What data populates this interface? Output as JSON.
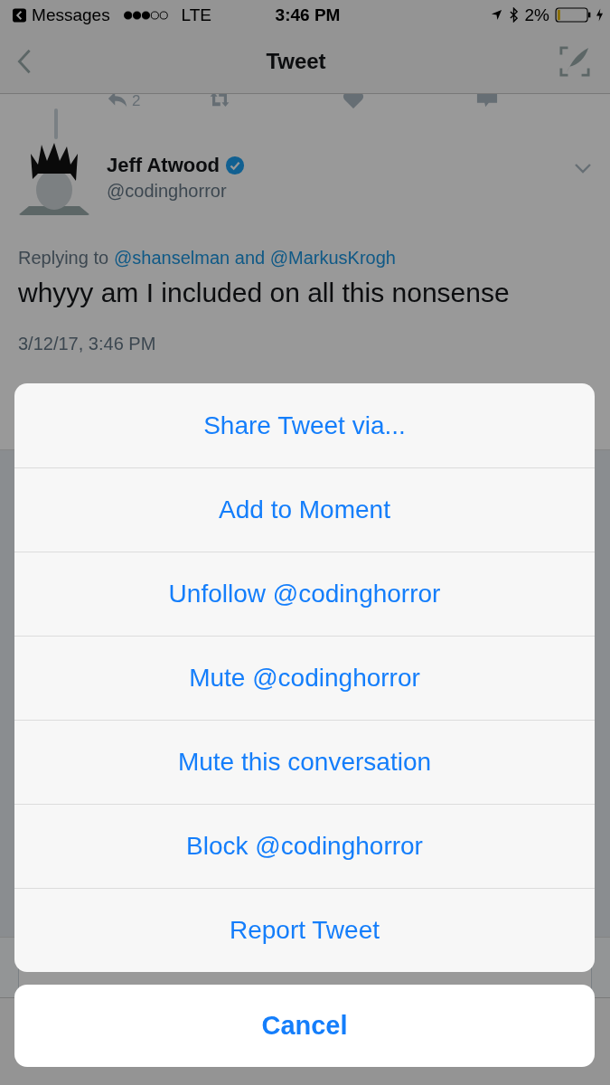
{
  "status_bar": {
    "back_app": "Messages",
    "network": "LTE",
    "time": "3:46 PM",
    "battery": "2%"
  },
  "nav_bar": {
    "title": "Tweet"
  },
  "previous_tweet": {
    "reply_count": "2"
  },
  "tweet": {
    "name": "Jeff Atwood",
    "verified": true,
    "handle": "@codinghorror",
    "replying_prefix": "Replying to",
    "replying_to": "@shanselman and @MarkusKrogh",
    "text": "whyyy am I included on all this nonsense",
    "timestamp": "3/12/17, 3:46 PM"
  },
  "action_sheet": {
    "actions": [
      "Share Tweet via...",
      "Add to Moment",
      "Unfollow @codinghorror",
      "Mute @codinghorror",
      "Mute this conversation",
      "Block @codinghorror",
      "Report Tweet"
    ],
    "cancel": "Cancel"
  }
}
